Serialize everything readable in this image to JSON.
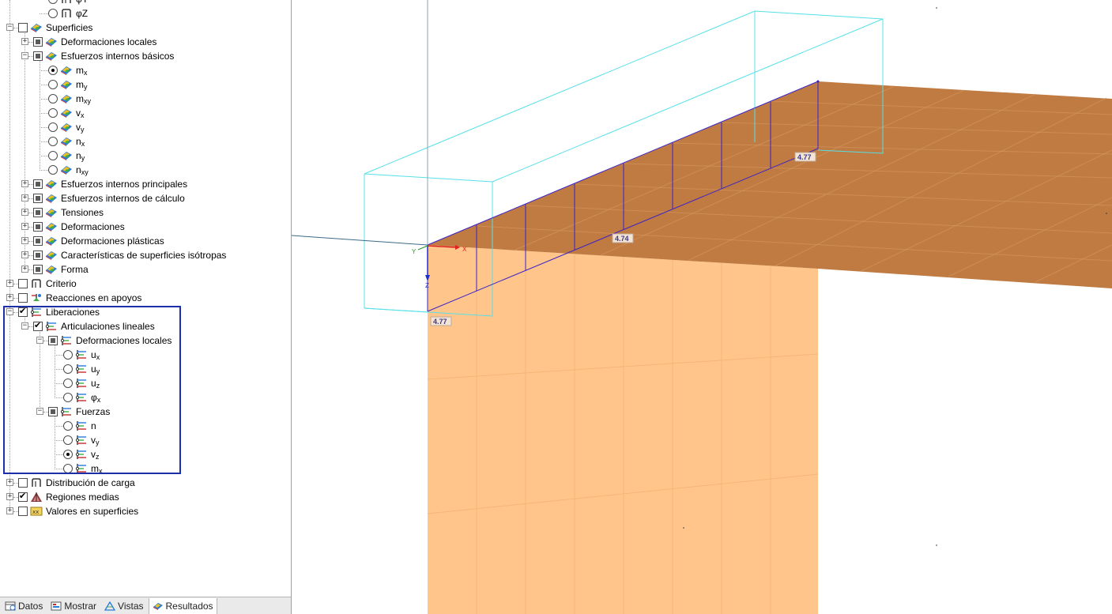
{
  "tree": {
    "top_partial": {
      "label": "φY"
    },
    "phi_z": {
      "label": "φZ"
    },
    "superficies": {
      "label": "Superficies"
    },
    "def_locales": {
      "label": "Deformaciones locales"
    },
    "esf_basicos": {
      "label": "Esfuerzos internos básicos"
    },
    "basic_items": [
      {
        "base": "m",
        "sub": "x",
        "selected": true
      },
      {
        "base": "m",
        "sub": "y",
        "selected": false
      },
      {
        "base": "m",
        "sub": "xy",
        "selected": false
      },
      {
        "base": "v",
        "sub": "x",
        "selected": false
      },
      {
        "base": "v",
        "sub": "y",
        "selected": false
      },
      {
        "base": "n",
        "sub": "x",
        "selected": false
      },
      {
        "base": "n",
        "sub": "y",
        "selected": false
      },
      {
        "base": "n",
        "sub": "xy",
        "selected": false
      }
    ],
    "surface_groups": [
      "Esfuerzos internos principales",
      "Esfuerzos internos de cálculo",
      "Tensiones",
      "Deformaciones",
      "Deformaciones plásticas",
      "Características de superficies isótropas",
      "Forma"
    ],
    "criterio": {
      "label": "Criterio"
    },
    "reacciones": {
      "label": "Reacciones en apoyos"
    },
    "liberaciones": {
      "label": "Liberaciones"
    },
    "articulaciones": {
      "label": "Articulaciones lineales"
    },
    "lib_def_locales": {
      "label": "Deformaciones locales"
    },
    "def_items": [
      {
        "base": "u",
        "sub": "x",
        "selected": false
      },
      {
        "base": "u",
        "sub": "y",
        "selected": false
      },
      {
        "base": "u",
        "sub": "z",
        "selected": false
      },
      {
        "base": "φ",
        "sub": "x",
        "selected": false
      }
    ],
    "fuerzas": {
      "label": "Fuerzas"
    },
    "force_items": [
      {
        "base": "n",
        "sub": "",
        "selected": false
      },
      {
        "base": "v",
        "sub": "y",
        "selected": false
      },
      {
        "base": "v",
        "sub": "z",
        "selected": true
      },
      {
        "base": "m",
        "sub": "x",
        "selected": false
      }
    ],
    "distribucion": {
      "label": "Distribución de carga"
    },
    "regiones": {
      "label": "Regiones medias"
    },
    "valores": {
      "label": "Valores en superficies"
    }
  },
  "tabs": [
    {
      "label": "Datos",
      "icon": "data-icon",
      "active": false
    },
    {
      "label": "Mostrar",
      "icon": "display-icon",
      "active": false
    },
    {
      "label": "Vistas",
      "icon": "views-icon",
      "active": false
    },
    {
      "label": "Resultados",
      "icon": "results-icon",
      "active": true
    }
  ],
  "viewport": {
    "value_labels": [
      "4.77",
      "4.74",
      "4.77"
    ],
    "axes": {
      "x": "X",
      "y": "Y",
      "z": "Z"
    },
    "colors": {
      "slab": "#b86d2c",
      "wall": "#ffc285",
      "bounding_box": "#55e0e8",
      "result_line": "#3a22c8",
      "axis_x": "#e02020",
      "axis_z": "#1f2fd0"
    }
  }
}
